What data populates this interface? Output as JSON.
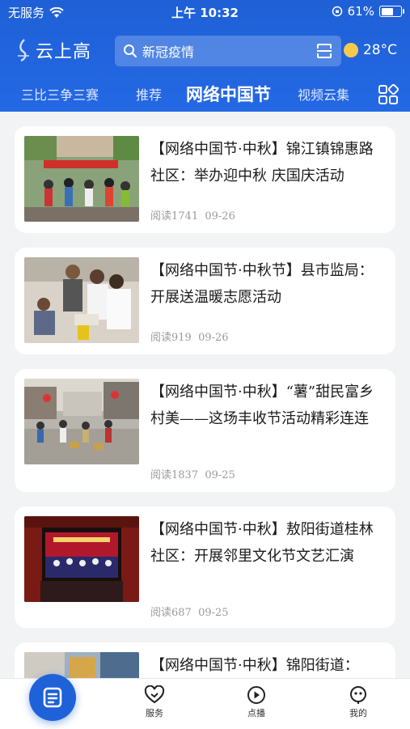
{
  "status_bar": {
    "carrier": "无服务",
    "time": "上午 10:32",
    "battery": "61%",
    "battery_level": 0.61
  },
  "header": {
    "logo_text": "云上高",
    "search_placeholder": "新冠疫情",
    "temperature": "28°C"
  },
  "tabs": [
    {
      "label": "三比三争三赛"
    },
    {
      "label": "推荐"
    },
    {
      "label": "网络中国节",
      "active": true
    },
    {
      "label": "视频云集"
    }
  ],
  "articles": [
    {
      "title": "【网络中国节·中秋】锦江镇锦惠路社区：举办迎中秋 庆国庆活动",
      "reads": "阅读1741",
      "date": "09-26"
    },
    {
      "title": "【网络中国节·中秋节】县市监局：开展送温暖志愿活动",
      "reads": "阅读919",
      "date": "09-26"
    },
    {
      "title": "【网络中国节·中秋】“薯”甜民富乡村美——这场丰收节活动精彩连连",
      "reads": "阅读1837",
      "date": "09-25"
    },
    {
      "title": "【网络中国节·中秋】敖阳街道桂林社区：开展邻里文化节文艺汇演",
      "reads": "阅读687",
      "date": "09-25"
    },
    {
      "title": "【网络中国节·中秋】锦阳街道：",
      "reads": "",
      "date": ""
    }
  ],
  "bottom_nav": [
    {
      "label": "服务"
    },
    {
      "label": "点播"
    },
    {
      "label": "我的"
    }
  ],
  "colors": {
    "brand_blue": "#1f60d6",
    "sun": "#f7c94a"
  }
}
